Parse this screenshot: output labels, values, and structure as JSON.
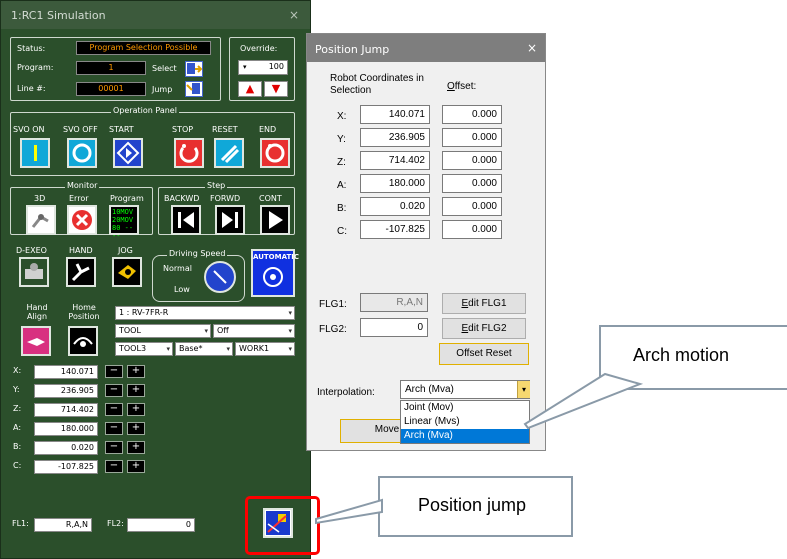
{
  "sim": {
    "title": "1:RC1  Simulation",
    "close": "×",
    "status_label": "Status:",
    "status_value": "Program Selection Possible",
    "program_label": "Program:",
    "program_value": "1",
    "select_label": "Select",
    "line_label": "Line #:",
    "line_value": "00001",
    "jump_label": "Jump",
    "override_label": "Override:",
    "override_value": "100",
    "operation_panel_label": "Operation Panel",
    "op_buttons": [
      "SVO ON",
      "SVO OFF",
      "START",
      "STOP",
      "RESET",
      "END"
    ],
    "monitor_label": "Monitor",
    "monitor_items": [
      "3D",
      "Error",
      "Program"
    ],
    "program_monitor_text": [
      "10MOV",
      "20MOV",
      "80 ----"
    ],
    "step_label": "Step",
    "step_items": [
      "BACKWD",
      "FORWD",
      "CONT"
    ],
    "misc_items": [
      "D-EXEO",
      "HAND",
      "JOG"
    ],
    "driving_speed_label": "Driving Speed",
    "speed_normal": "Normal",
    "speed_low": "Low",
    "automatic_label": "AUTOMATIC",
    "hand_align": "Hand Align",
    "home_position": "Home Position",
    "robot_model": "1 : RV-7FR-R",
    "tool_select": "TOOL",
    "off_select": "Off",
    "tool3_select": "TOOL3",
    "base_select": "Base*",
    "work_select": "WORK1",
    "coords": [
      {
        "axis": "X:",
        "value": "140.071"
      },
      {
        "axis": "Y:",
        "value": "236.905"
      },
      {
        "axis": "Z:",
        "value": "714.402"
      },
      {
        "axis": "A:",
        "value": "180.000"
      },
      {
        "axis": "B:",
        "value": "0.020"
      },
      {
        "axis": "C:",
        "value": "-107.825"
      }
    ],
    "minus": "−",
    "plus": "+",
    "fl1_label": "FL1:",
    "fl1_value": "R,A,N",
    "fl2_label": "FL2:",
    "fl2_value": "0"
  },
  "pj": {
    "title": "Position Jump",
    "close": "×",
    "robot_coords_label": "Robot Coordinates in Selection",
    "offset_label": "Offset:",
    "rows": [
      {
        "axis": "X:",
        "value": "140.071",
        "offset": "0.000"
      },
      {
        "axis": "Y:",
        "value": "236.905",
        "offset": "0.000"
      },
      {
        "axis": "Z:",
        "value": "714.402",
        "offset": "0.000"
      },
      {
        "axis": "A:",
        "value": "180.000",
        "offset": "0.000"
      },
      {
        "axis": "B:",
        "value": "0.020",
        "offset": "0.000"
      },
      {
        "axis": "C:",
        "value": "-107.825",
        "offset": "0.000"
      }
    ],
    "flg1_label": "FLG1:",
    "flg1_value": "R,A,N",
    "flg2_label": "FLG2:",
    "flg2_value": "0",
    "edit_flg1": "Edit FLG1",
    "edit_flg2": "Edit FLG2",
    "offset_reset": "Offset Reset",
    "interpolation_label": "Interpolation:",
    "interpolation_value": "Arch (Mva)",
    "interpolation_options": [
      "Joint (Mov)",
      "Linear (Mvs)",
      "Arch (Mva)"
    ],
    "move_label": "Move"
  },
  "callouts": {
    "arch_motion": "Arch motion",
    "position_jump": "Position jump"
  },
  "colors": {
    "panel_green": "#2b4f2b",
    "highlight_red": "#ff0000",
    "selection_blue": "#0078d7"
  }
}
